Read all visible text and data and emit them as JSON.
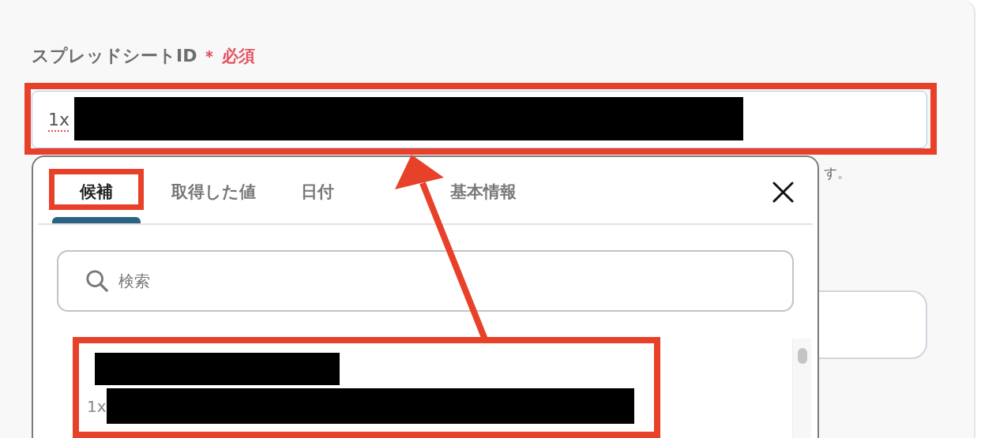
{
  "field": {
    "label": "スプレッドシートID",
    "required_mark": "＊",
    "required_text": "必須",
    "value": "1x",
    "value_redacted": true
  },
  "hint": {
    "text": "す。"
  },
  "popup": {
    "tabs": [
      {
        "label": "候補",
        "selected": true
      },
      {
        "label": "取得した値",
        "selected": false
      },
      {
        "label": "日付",
        "selected": false
      },
      {
        "label": "基本情報",
        "selected": false
      }
    ],
    "search": {
      "placeholder": "検索"
    },
    "items": [
      {
        "subtitle": "1x",
        "redacted": true
      }
    ]
  }
}
